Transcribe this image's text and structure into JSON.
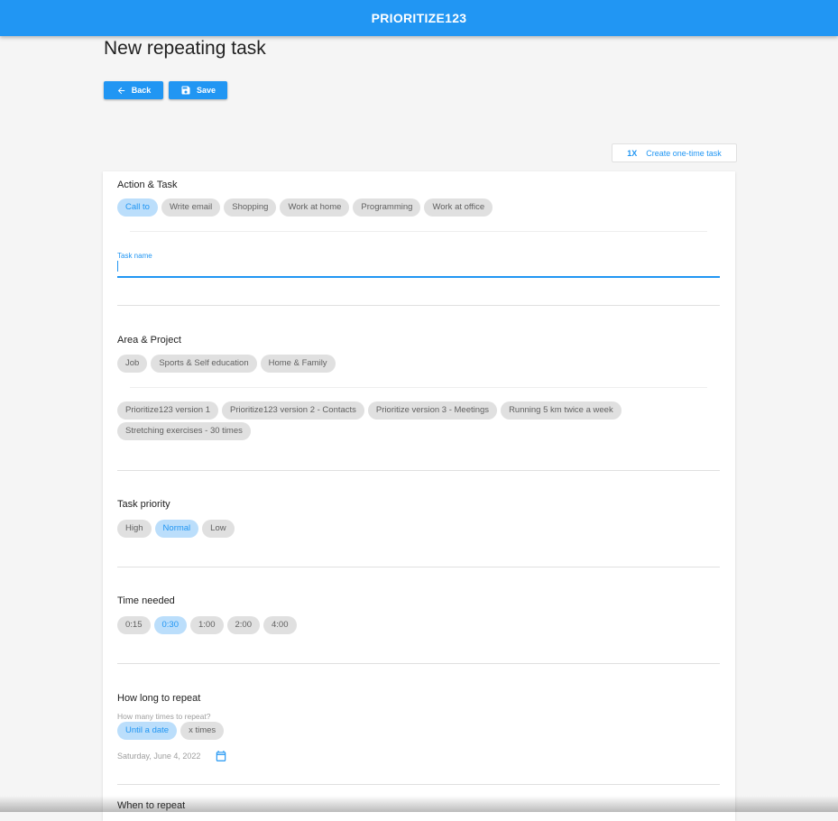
{
  "appbar": {
    "title": "PRIORITIZE123"
  },
  "page": {
    "title": "New repeating task"
  },
  "toolbar": {
    "back_label": "Back",
    "save_label": "Save"
  },
  "onetime": {
    "badge": "1X",
    "label": "Create one-time task"
  },
  "colors": {
    "primary": "#2196f3",
    "chip_selected_bg": "#bbdefb",
    "chip_bg": "#e0e0e0"
  },
  "action": {
    "title": "Action & Task",
    "chips": [
      "Call to",
      "Write email",
      "Shopping",
      "Work at home",
      "Programming",
      "Work at office"
    ],
    "selected": "Call to"
  },
  "task": {
    "label": "Task name",
    "value": ""
  },
  "area": {
    "title": "Area & Project",
    "areas": [
      "Job",
      "Sports & Self education",
      "Home & Family"
    ],
    "projects": [
      "Prioritize123 version 1",
      "Prioritize123 version 2 - Contacts",
      "Prioritize version 3 - Meetings",
      "Running 5 km twice a week",
      "Stretching exercises - 30 times"
    ]
  },
  "priority": {
    "title": "Task priority",
    "chips": [
      "High",
      "Normal",
      "Low"
    ],
    "selected": "Normal"
  },
  "time": {
    "title": "Time needed",
    "chips": [
      "0:15",
      "0:30",
      "1:00",
      "2:00",
      "4:00"
    ],
    "selected": "0:30"
  },
  "repeat": {
    "title": "How long to repeat",
    "sublabel": "How many times to repeat?",
    "chips": [
      "Until a date",
      "x times"
    ],
    "selected": "Until a date",
    "date": "Saturday, June 4, 2022"
  },
  "when": {
    "title": "When to repeat"
  }
}
